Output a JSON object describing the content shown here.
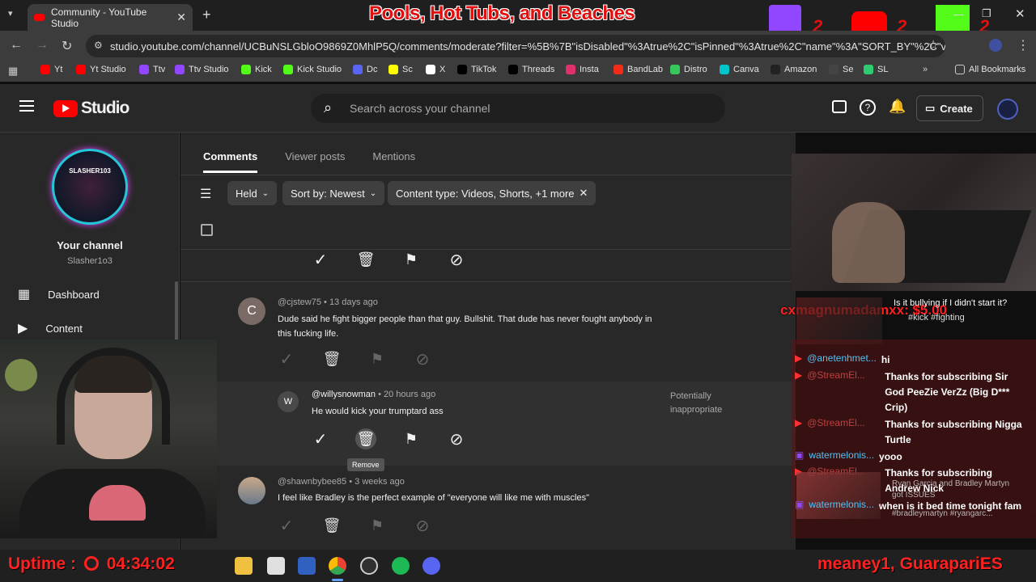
{
  "browser": {
    "tab_title": "Community - YouTube Studio",
    "overlay_title": "Pools, Hot Tubs, and Beaches",
    "url": "studio.youtube.com/channel/UCBuNSLGbloO9869Z0MhlP5Q/comments/moderate?filter=%5B%7B\"isDisabled\"%3Atrue%2C\"isPinned\"%3Atrue%2C\"name\"%3A\"SORT_BY\"%2C\"val...",
    "bookmarks": [
      {
        "label": "Yt",
        "color": "#ff0000"
      },
      {
        "label": "Yt Studio",
        "color": "#ff0000"
      },
      {
        "label": "Ttv",
        "color": "#9146ff"
      },
      {
        "label": "Ttv Studio",
        "color": "#9146ff"
      },
      {
        "label": "Kick",
        "color": "#53fc18"
      },
      {
        "label": "Kick Studio",
        "color": "#53fc18"
      },
      {
        "label": "Dc",
        "color": "#5865f2"
      },
      {
        "label": "Sc",
        "color": "#fffc00"
      },
      {
        "label": "X",
        "color": "#ffffff"
      },
      {
        "label": "TikTok",
        "color": "#000000"
      },
      {
        "label": "Threads",
        "color": "#000000"
      },
      {
        "label": "Insta",
        "color": "#e1306c"
      },
      {
        "label": "BandLab",
        "color": "#f12c18"
      },
      {
        "label": "Distro",
        "color": "#35c759"
      },
      {
        "label": "Canva",
        "color": "#00c4cc"
      },
      {
        "label": "Amazon",
        "color": "#222222"
      },
      {
        "label": "Se",
        "color": "#444444"
      },
      {
        "label": "SL",
        "color": "#2ecc71"
      }
    ],
    "all_bookmarks": "All Bookmarks",
    "overlay_counts": [
      "2",
      "2",
      "2"
    ]
  },
  "studio": {
    "logo_text": "Studio",
    "search_placeholder": "Search across your channel",
    "create_label": "Create",
    "channel_name": "Your channel",
    "channel_handle": "Slasher1o3",
    "avatar_text": "SLASHER103",
    "nav": [
      {
        "label": "Dashboard",
        "icon": "dashboard-icon"
      },
      {
        "label": "Content",
        "icon": "content-icon"
      }
    ],
    "tabs": [
      "Comments",
      "Viewer posts",
      "Mentions"
    ],
    "filters": {
      "held": "Held",
      "sort": "Sort by: Newest",
      "content_type": "Content type: Videos, Shorts, +1 more"
    },
    "comments": [
      {
        "avatar_letter": "C",
        "avatar_color": "#7a6a66",
        "author": "@cjstew75",
        "time": "13 days ago",
        "text": "Dude said he fight bigger people than that guy. Bullshit. That dude has never fought anybody in this fucking life."
      },
      {
        "avatar_letter": "W",
        "avatar_color": "#4a4a4a",
        "author": "@willysnowman",
        "time": "20 hours ago",
        "text": "He would kick your trumptard ass",
        "flag": "Potentially inappropriate",
        "tooltip": "Remove"
      },
      {
        "avatar_letter": "",
        "avatar_color": "#8a8a8a",
        "author": "@shawnbybee85",
        "time": "3 weeks ago",
        "text": "I feel like Bradley is the perfect example of \"everyone will like me with muscles\""
      }
    ]
  },
  "stream": {
    "donation": "cxmagnumadamxx: $5.00",
    "video_title": "Is it bullying if I didn't start it?",
    "video_tags": "#kick #fighting",
    "video2_title": "Ryan Garcia and Bradley Martyn got ISSUES",
    "video2_tags": "#bradleymartyn #ryangarc...",
    "chat": [
      {
        "name": "@anetenhmet...",
        "msg": "hi"
      },
      {
        "name": "@StreamEl...",
        "msg": "Thanks for subscribing Sir God PeeZie VerZz (Big D*** Crip)"
      },
      {
        "name": "@StreamEl...",
        "msg": "Thanks for subscribing Nigga Turtle"
      },
      {
        "name": "watermelonis...",
        "msg": "yooo"
      },
      {
        "name": "@StreamEl...",
        "msg": "Thanks for subscribing Andrew Nick"
      },
      {
        "name": "watermelonis...",
        "msg": "when is it bed time tonight fam"
      }
    ],
    "uptime_label": "Uptime :",
    "uptime_value": "04:34:02",
    "ticker": "meaney1, GuarapariES"
  }
}
